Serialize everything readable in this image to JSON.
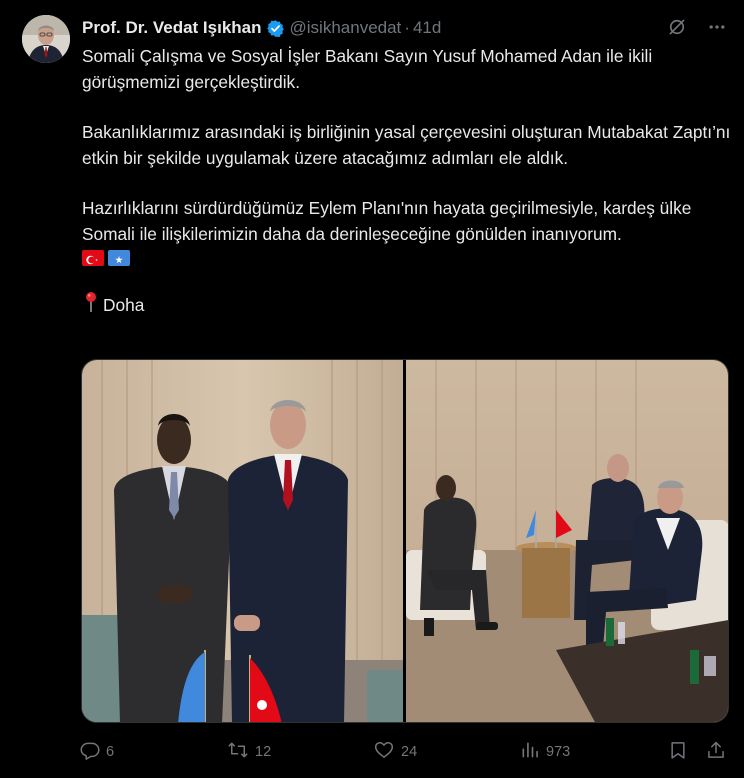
{
  "tweet": {
    "author_name": "Prof. Dr. Vedat Işıkhan",
    "handle": "@isikhanvedat",
    "separator": "·",
    "time": "41d",
    "paragraphs": [
      "Somali Çalışma ve Sosyal İşler Bakanı Sayın Yusuf Mohamed Adan ile ikili görüşmemizi gerçekleştirdik.",
      "Bakanlıklarımız arasındaki iş birliğinin yasal çerçevesini oluşturan Mutabakat Zaptı’nı etkin bir şekilde uygulamak üzere atacağımız adımları ele aldık.",
      "Hazırlıklarını sürdürdüğümüz Eylem Planı'nın hayata geçirilmesiyle, kardeş ülke Somali ile ilişkilerimizin daha da derinleşeceğine gönülden inanıyorum."
    ],
    "flags": [
      "turkey-flag",
      "somalia-flag"
    ],
    "location_icon": "round-pushpin-icon",
    "location": "Doha"
  },
  "stats": {
    "replies": "6",
    "retweets": "12",
    "likes": "24",
    "views": "973"
  },
  "icons": {
    "verified": "verified-badge-icon",
    "grok": "grok-icon",
    "more": "more-icon",
    "reply": "reply-icon",
    "retweet": "retweet-icon",
    "like": "heart-icon",
    "views": "views-icon",
    "bookmark": "bookmark-icon",
    "share": "share-icon"
  },
  "colors": {
    "background": "#000000",
    "text": "#e7e9ea",
    "muted": "#71767b",
    "verified": "#1d9bf0"
  }
}
